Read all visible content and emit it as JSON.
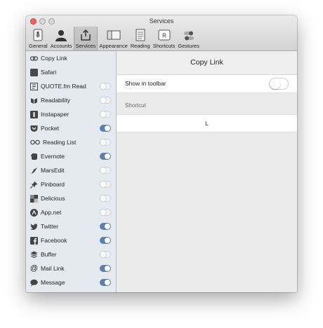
{
  "window": {
    "title": "Services"
  },
  "toolbar": {
    "items": [
      {
        "label": "General",
        "icon": "general-switch-icon",
        "active": false
      },
      {
        "label": "Accounts",
        "icon": "accounts-person-icon",
        "active": false
      },
      {
        "label": "Services",
        "icon": "services-share-icon",
        "active": true
      },
      {
        "label": "Appearance",
        "icon": "appearance-layout-icon",
        "active": false
      },
      {
        "label": "Reading",
        "icon": "reading-document-icon",
        "active": false
      },
      {
        "label": "Shortcuts",
        "icon": "shortcuts-key-icon",
        "active": false
      },
      {
        "label": "Gestures",
        "icon": "gestures-switch-icon",
        "active": false
      }
    ]
  },
  "sidebar": {
    "items": [
      {
        "label": "Copy Link",
        "icon": "copy-link-icon",
        "toggle": null,
        "selected": true
      },
      {
        "label": "Safari",
        "icon": "safari-icon",
        "toggle": null,
        "selected": false
      },
      {
        "label": "QUOTE.fm Read",
        "icon": "quotefm-icon",
        "toggle": false,
        "selected": false
      },
      {
        "label": "Readability",
        "icon": "readability-icon",
        "toggle": false,
        "selected": false
      },
      {
        "label": "Instapaper",
        "icon": "instapaper-icon",
        "toggle": false,
        "selected": false
      },
      {
        "label": "Pocket",
        "icon": "pocket-icon",
        "toggle": true,
        "selected": false
      },
      {
        "label": "Reading List",
        "icon": "reading-list-glasses-icon",
        "toggle": false,
        "selected": false
      },
      {
        "label": "Evernote",
        "icon": "evernote-elephant-icon",
        "toggle": true,
        "selected": false
      },
      {
        "label": "MarsEdit",
        "icon": "marsedit-rocket-icon",
        "toggle": false,
        "selected": false
      },
      {
        "label": "Pinboard",
        "icon": "pinboard-pin-icon",
        "toggle": false,
        "selected": false
      },
      {
        "label": "Delicious",
        "icon": "delicious-icon",
        "toggle": false,
        "selected": false
      },
      {
        "label": "App.net",
        "icon": "appnet-icon",
        "toggle": false,
        "selected": false
      },
      {
        "label": "Twitter",
        "icon": "twitter-bird-icon",
        "toggle": true,
        "selected": false
      },
      {
        "label": "Facebook",
        "icon": "facebook-icon",
        "toggle": true,
        "selected": false
      },
      {
        "label": "Buffer",
        "icon": "buffer-stack-icon",
        "toggle": false,
        "selected": false
      },
      {
        "label": "Mail Link",
        "icon": "mail-at-icon",
        "toggle": true,
        "selected": false
      },
      {
        "label": "Message",
        "icon": "message-bubble-icon",
        "toggle": true,
        "selected": false
      }
    ]
  },
  "detail": {
    "title": "Copy Link",
    "show_in_toolbar_label": "Show in toolbar",
    "show_in_toolbar": false,
    "shortcut_section": "Shortcut",
    "shortcut_value": "L"
  },
  "colors": {
    "toggle_on": "#5b7fa6",
    "sidebar_bg": "#e5e9f0",
    "sidebar_selected": "#c9ccd2",
    "close": "#fc605b",
    "minimize": "#d8d8d8",
    "zoom": "#d8d8d8"
  }
}
